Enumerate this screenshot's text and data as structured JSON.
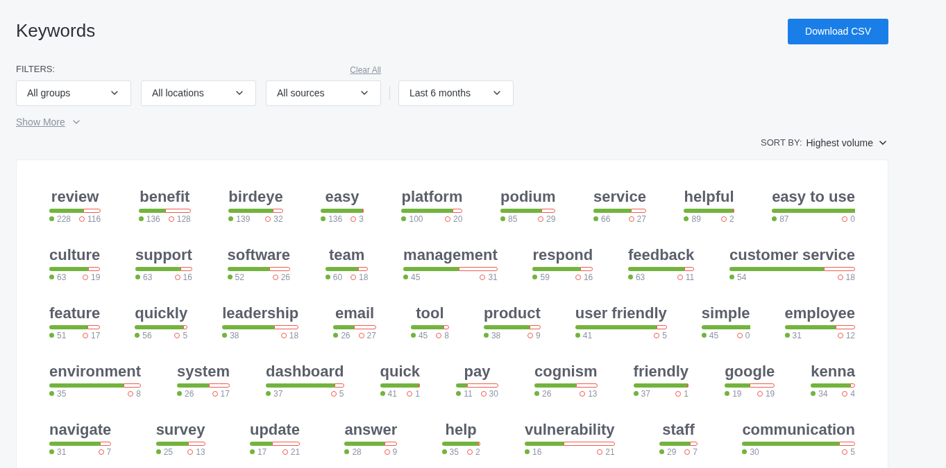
{
  "title": "Keywords",
  "download_button": "Download CSV",
  "filters": {
    "label": "FILTERS:",
    "clear_all": "Clear All",
    "dropdowns": [
      "All groups",
      "All locations",
      "All sources",
      "Last 6 months"
    ],
    "show_more": "Show More"
  },
  "sort": {
    "label": "SORT BY:",
    "value": "Highest volume"
  },
  "keyword_rows": [
    [
      {
        "word": "review",
        "positive": "228",
        "negative": "116"
      },
      {
        "word": "benefit",
        "positive": "136",
        "negative": "128"
      },
      {
        "word": "birdeye",
        "positive": "139",
        "negative": "32"
      },
      {
        "word": "easy",
        "positive": "136",
        "negative": "3"
      },
      {
        "word": "platform",
        "positive": "100",
        "negative": "20"
      },
      {
        "word": "podium",
        "positive": "85",
        "negative": "29"
      },
      {
        "word": "service",
        "positive": "66",
        "negative": "27"
      },
      {
        "word": "helpful",
        "positive": "89",
        "negative": "2"
      },
      {
        "word": "easy to use",
        "positive": "87",
        "negative": "0"
      }
    ],
    [
      {
        "word": "culture",
        "positive": "63",
        "negative": "19"
      },
      {
        "word": "support",
        "positive": "63",
        "negative": "16"
      },
      {
        "word": "software",
        "positive": "52",
        "negative": "26"
      },
      {
        "word": "team",
        "positive": "60",
        "negative": "18"
      },
      {
        "word": "management",
        "positive": "45",
        "negative": "31"
      },
      {
        "word": "respond",
        "positive": "59",
        "negative": "16"
      },
      {
        "word": "feedback",
        "positive": "63",
        "negative": "11"
      },
      {
        "word": "customer service",
        "positive": "54",
        "negative": "18"
      }
    ],
    [
      {
        "word": "feature",
        "positive": "51",
        "negative": "17"
      },
      {
        "word": "quickly",
        "positive": "56",
        "negative": "5"
      },
      {
        "word": "leadership",
        "positive": "38",
        "negative": "18"
      },
      {
        "word": "email",
        "positive": "26",
        "negative": "27"
      },
      {
        "word": "tool",
        "positive": "45",
        "negative": "8"
      },
      {
        "word": "product",
        "positive": "38",
        "negative": "9"
      },
      {
        "word": "user friendly",
        "positive": "41",
        "negative": "5"
      },
      {
        "word": "simple",
        "positive": "45",
        "negative": "0"
      },
      {
        "word": "employee",
        "positive": "31",
        "negative": "12"
      }
    ],
    [
      {
        "word": "environment",
        "positive": "35",
        "negative": "8"
      },
      {
        "word": "system",
        "positive": "26",
        "negative": "17"
      },
      {
        "word": "dashboard",
        "positive": "37",
        "negative": "5"
      },
      {
        "word": "quick",
        "positive": "41",
        "negative": "1"
      },
      {
        "word": "pay",
        "positive": "11",
        "negative": "30"
      },
      {
        "word": "cognism",
        "positive": "26",
        "negative": "13"
      },
      {
        "word": "friendly",
        "positive": "37",
        "negative": "1"
      },
      {
        "word": "google",
        "positive": "19",
        "negative": "19"
      },
      {
        "word": "kenna",
        "positive": "34",
        "negative": "4"
      }
    ],
    [
      {
        "word": "navigate",
        "positive": "31",
        "negative": "7"
      },
      {
        "word": "survey",
        "positive": "25",
        "negative": "13"
      },
      {
        "word": "update",
        "positive": "17",
        "negative": "21"
      },
      {
        "word": "answer",
        "positive": "28",
        "negative": "9"
      },
      {
        "word": "help",
        "positive": "35",
        "negative": "2"
      },
      {
        "word": "vulnerability",
        "positive": "16",
        "negative": "21"
      },
      {
        "word": "staff",
        "positive": "29",
        "negative": "7"
      },
      {
        "word": "communication",
        "positive": "30",
        "negative": "5"
      }
    ]
  ]
}
